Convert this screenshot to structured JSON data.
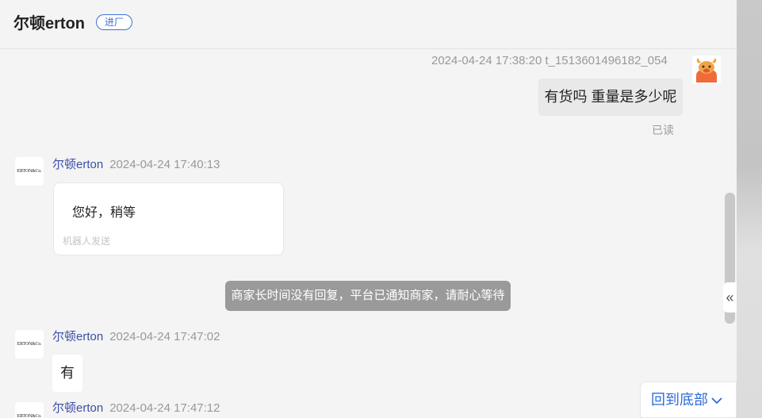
{
  "header": {
    "shop_name": "尔顿erton",
    "badge": "进厂"
  },
  "messages": {
    "mine": {
      "meta": "2024-04-24 17:38:20  t_1513601496182_054",
      "text": "有货吗 重量是多少呢",
      "status": "已读"
    },
    "shop1": {
      "sender": "尔顿erton",
      "time": "2024-04-24 17:40:13",
      "text": "您好，稍等",
      "note": "机器人发送"
    },
    "system": {
      "text": "商家长时间没有回复，平台已通知商家，请耐心等待"
    },
    "shop2": {
      "sender": "尔顿erton",
      "time": "2024-04-24 17:47:02",
      "text": "有"
    },
    "shop3": {
      "sender": "尔顿erton",
      "time": "2024-04-24 17:47:12"
    }
  },
  "shop_avatar_text": "ERTON&Co.",
  "scroll_button": {
    "label": "回到底部",
    "icon": "chevron-down-icon"
  },
  "collapse_tab": {
    "icon": "double-chevron-left-icon",
    "glyph": "«"
  },
  "colors": {
    "accent": "#2f6bd8",
    "sender_name": "#3a4ea8",
    "system_notice_bg": "#9a9a9a"
  }
}
